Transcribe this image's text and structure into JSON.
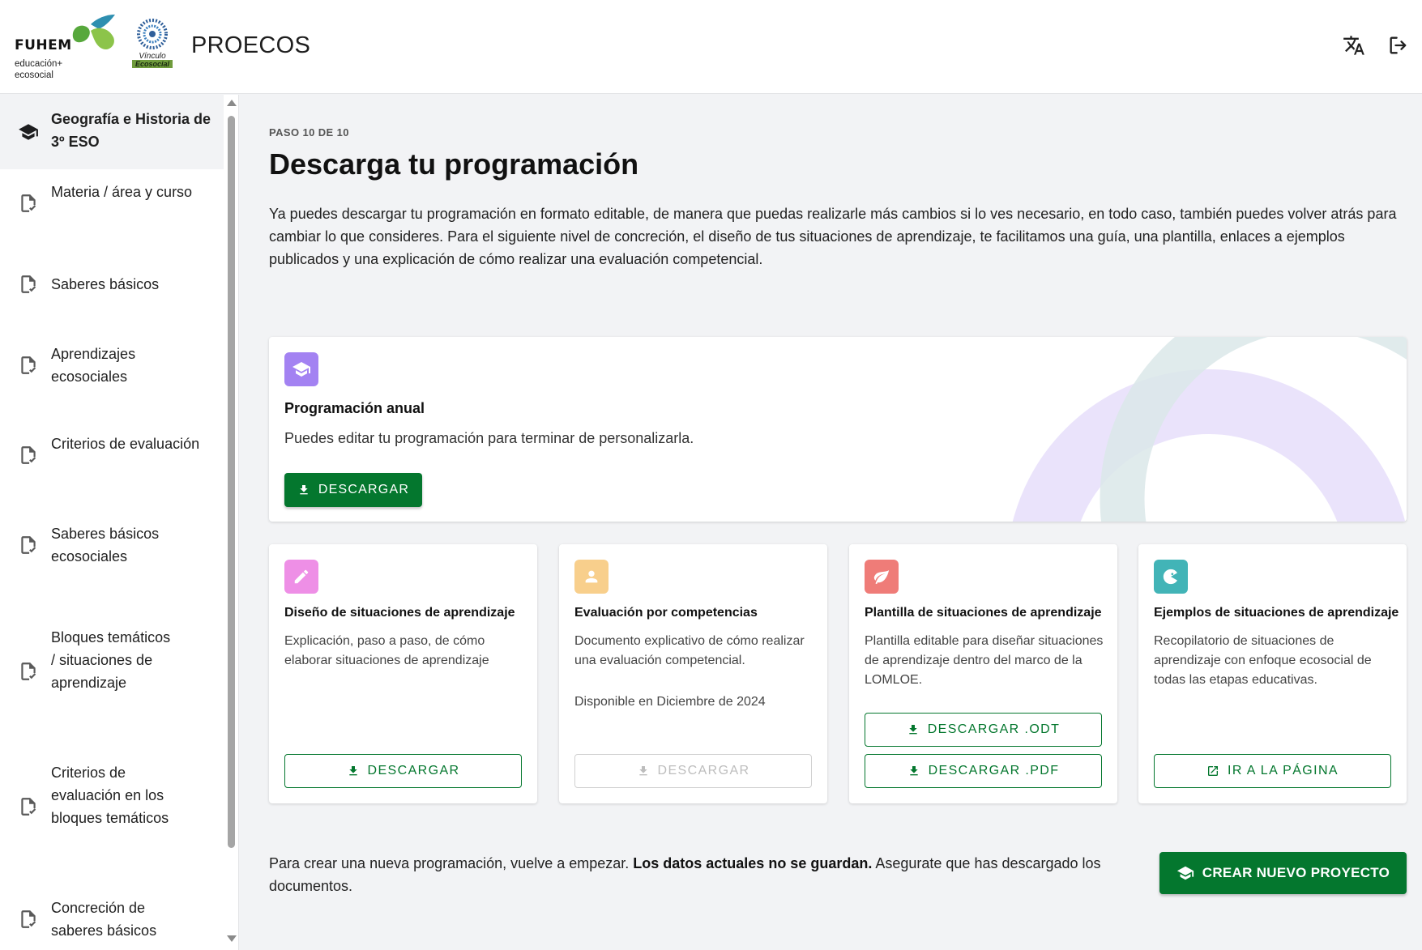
{
  "header": {
    "brand_fuhem": "FUHEM",
    "brand_fuhem_sub": "educación+ ecosocial",
    "brand_vinculo": "Vínculo",
    "brand_vinculo_eco": "Ecosocial",
    "app_title": "PROECOS",
    "icons": [
      "translate-icon",
      "logout-icon"
    ]
  },
  "sidebar": {
    "items": [
      {
        "label": "Geografía e Historia de 3º ESO",
        "icon": "graduation-cap-icon",
        "active": true
      },
      {
        "label": "Materia / área y curso",
        "icon": "document-check-icon"
      },
      {
        "label": "Saberes básicos",
        "icon": "document-check-icon"
      },
      {
        "label": "Aprendizajes ecosociales",
        "icon": "document-check-icon"
      },
      {
        "label": "Criterios de evaluación",
        "icon": "document-check-icon"
      },
      {
        "label": "Saberes básicos ecosociales",
        "icon": "document-check-icon"
      },
      {
        "label": "Bloques temáticos / situaciones de aprendizaje",
        "icon": "document-check-icon"
      },
      {
        "label": "Criterios de evaluación en los bloques temáticos",
        "icon": "document-check-icon"
      },
      {
        "label": "Concreción de saberes básicos",
        "icon": "document-check-icon"
      }
    ]
  },
  "main": {
    "step": "PASO 10 DE 10",
    "title": "Descarga tu programación",
    "intro": "Ya puedes descargar tu programación en formato editable, de manera que puedas realizarle más cambios si lo ves necesario, en todo caso, también puedes volver atrás para cambiar lo que consideres. Para el siguiente nivel de concreción, el diseño de tus situaciones de aprendizaje, te facilitamos una guía, una plantilla, enlaces a ejemplos publicados y una explicación de cómo realizar una evaluación competencial.",
    "annual": {
      "title": "Programación anual",
      "desc": "Puedes editar tu programación para terminar de personalizarla.",
      "button": "DESCARGAR"
    },
    "cards": [
      {
        "title": "Diseño de situaciones de aprendizaje",
        "desc": "Explicación, paso a paso, de cómo elaborar situaciones de aprendizaje",
        "button": "DESCARGAR",
        "color": "#ee8fe6"
      },
      {
        "title": "Evaluación por competencias",
        "desc": "Documento explicativo de cómo realizar una evaluación competencial.",
        "note": "Disponible en Diciembre de 2024",
        "button": "DESCARGAR",
        "color": "#f8cf8c"
      },
      {
        "title": "Plantilla de situaciones de aprendizaje",
        "desc": "Plantilla editable para diseñar situaciones de aprendizaje dentro del marco de la LOMLOE.",
        "button_odt": "DESCARGAR .ODT",
        "button_pdf": "DESCARGAR .PDF",
        "color": "#ef7c78"
      },
      {
        "title": "Ejemplos de situaciones de aprendizaje",
        "desc": "Recopilatorio de situaciones de aprendizaje con enfoque ecosocial de todas las etapas educativas.",
        "button": "IR A LA PÁGINA",
        "color": "#42b4b7"
      }
    ],
    "footer": {
      "text_before": "Para crear una nueva programación, vuelve a empezar. ",
      "text_bold": "Los datos actuales no se guardan.",
      "text_after": " Asegurate que has descargado los documentos.",
      "button": "CREAR NUEVO PROYECTO"
    }
  },
  "colors": {
    "primary": "#04772e",
    "purple": "#a382f2"
  }
}
